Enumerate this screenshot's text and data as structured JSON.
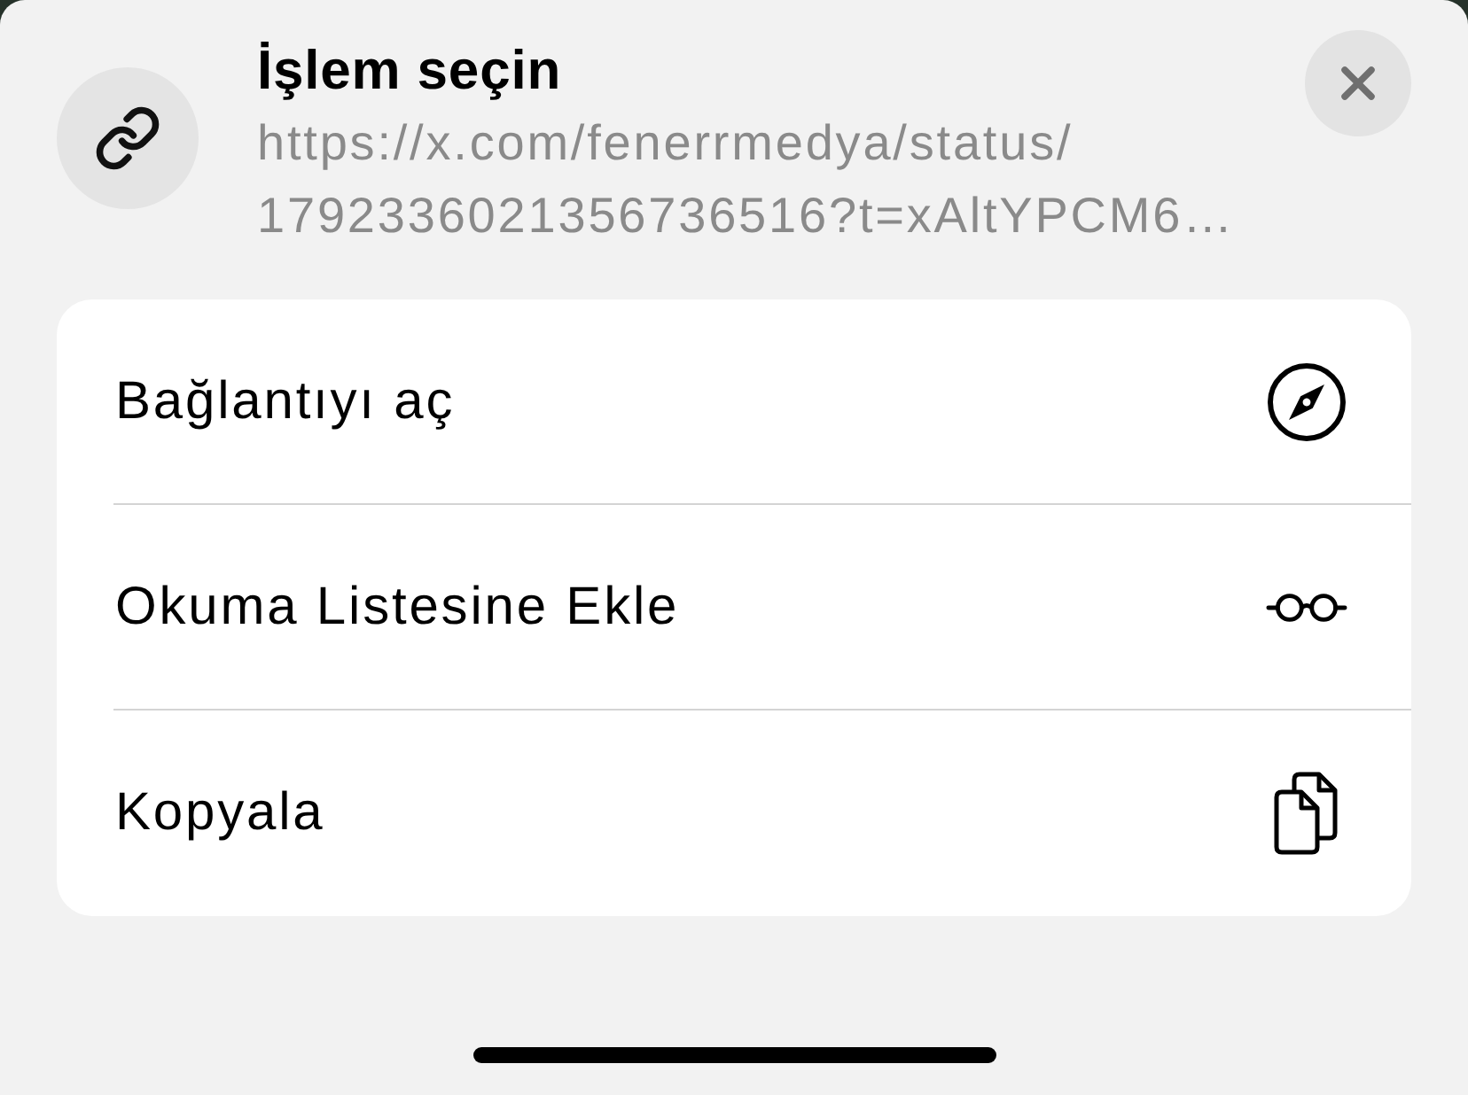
{
  "sheet": {
    "title": "İşlem seçin",
    "url": "https://x.com/fenerrmedya/status/\n1792336021356736516?t=xAltYPCM6…"
  },
  "actions": [
    {
      "label": "Bağlantıyı aç",
      "kind": "open"
    },
    {
      "label": "Okuma Listesine Ekle",
      "kind": "reading-list"
    },
    {
      "label": "Kopyala",
      "kind": "copy"
    }
  ]
}
